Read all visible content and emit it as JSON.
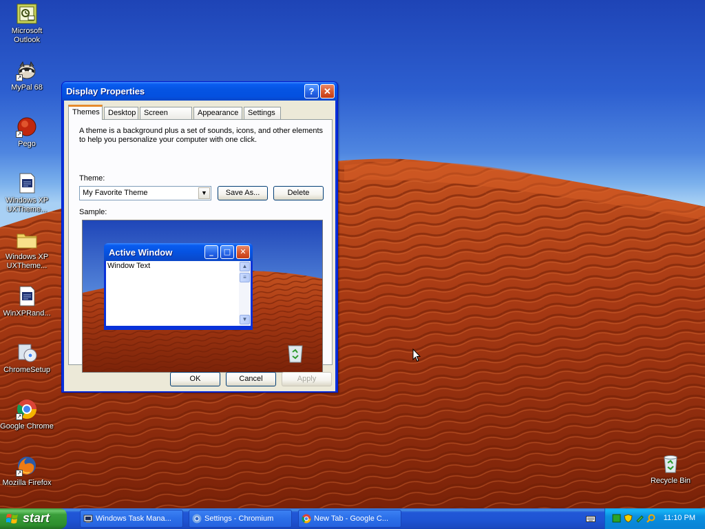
{
  "desktop": {
    "icons": [
      {
        "label": "Microsoft Outlook",
        "icon": "outlook-icon",
        "shortcut": false
      },
      {
        "label": "MyPal 68",
        "icon": "mypal-icon",
        "shortcut": true
      },
      {
        "label": "Pego",
        "icon": "pego-icon",
        "shortcut": true
      },
      {
        "label": "Windows XP UXTheme...",
        "icon": "document-icon",
        "shortcut": false
      },
      {
        "label": "Windows XP UXTheme...",
        "icon": "folder-icon",
        "shortcut": false
      },
      {
        "label": "WinXPRand...",
        "icon": "document-icon",
        "shortcut": false
      },
      {
        "label": "ChromeSetup",
        "icon": "installer-icon",
        "shortcut": false
      },
      {
        "label": "Google Chrome",
        "icon": "chrome-icon",
        "shortcut": true
      },
      {
        "label": "Mozilla Firefox",
        "icon": "firefox-icon",
        "shortcut": true
      }
    ],
    "recycle_bin": {
      "label": "Recycle Bin",
      "icon": "recycle-bin-icon"
    }
  },
  "dialog": {
    "title": "Display Properties",
    "help_glyph": "?",
    "close_glyph": "✕",
    "tabs": [
      {
        "label": "Themes",
        "active": true
      },
      {
        "label": "Desktop",
        "active": false
      },
      {
        "label": "Screen Saver",
        "active": false
      },
      {
        "label": "Appearance",
        "active": false
      },
      {
        "label": "Settings",
        "active": false
      }
    ],
    "description": "A theme is a background plus a set of sounds, icons, and other elements to help you personalize your computer with one click.",
    "theme_label": "Theme:",
    "theme_value": "My Favorite Theme",
    "save_as_label": "Save As...",
    "delete_label": "Delete",
    "sample_label": "Sample:",
    "sample_window": {
      "title": "Active Window",
      "text": "Window Text"
    },
    "ok_label": "OK",
    "cancel_label": "Cancel",
    "apply_label": "Apply"
  },
  "taskbar": {
    "start_label": "start",
    "tasks": [
      {
        "label": "Windows Task Mana...",
        "icon": "task-manager-icon"
      },
      {
        "label": "Settings - Chromium",
        "icon": "chromium-icon"
      },
      {
        "label": "New Tab - Google C...",
        "icon": "chrome-icon"
      }
    ],
    "clock": "11:10 PM"
  },
  "colors": {
    "xp_blue": "#0831d9",
    "dune_red": "#b8421c",
    "sky": "#2d5fd0",
    "start_green": "#3a9e3a"
  }
}
